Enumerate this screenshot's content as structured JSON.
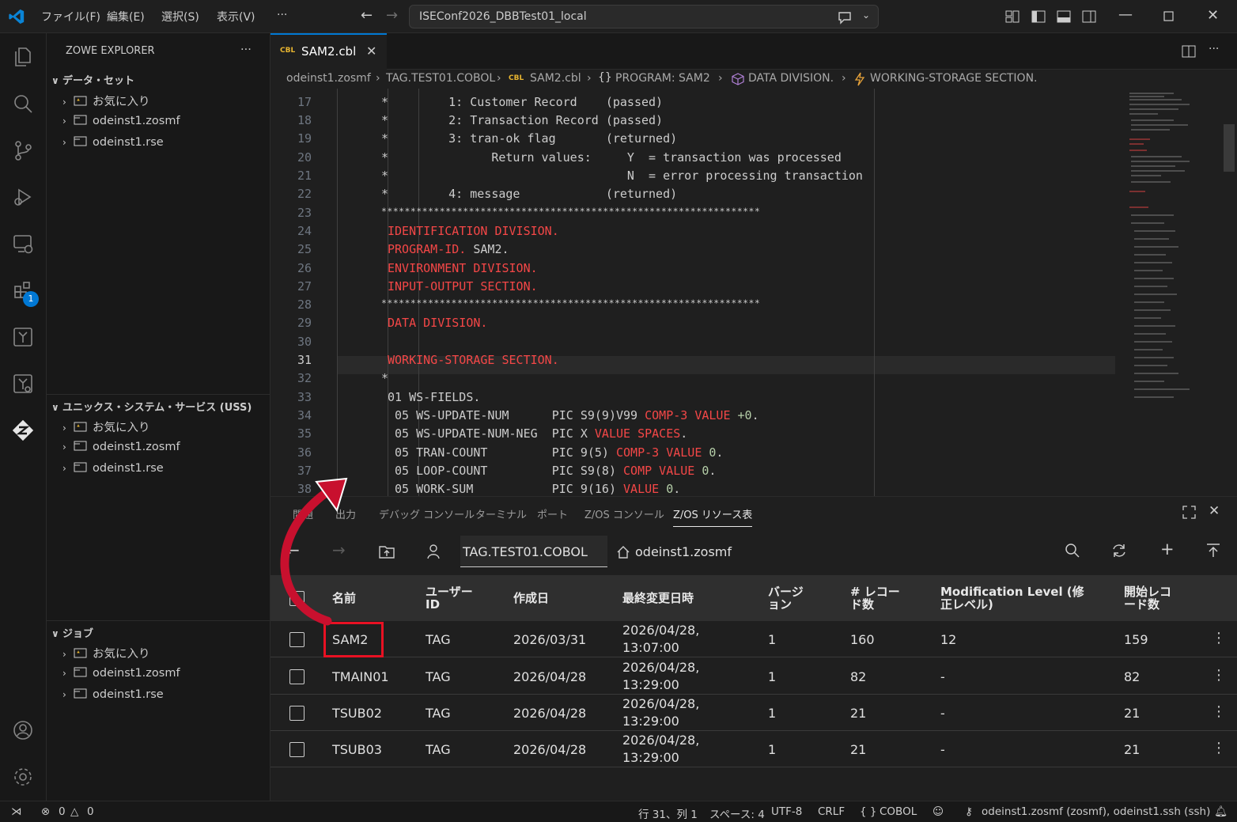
{
  "titlebar": {
    "menus": [
      "ファイル(F)",
      "編集(E)",
      "選択(S)",
      "表示(V)",
      "···"
    ],
    "command_center": "ISEConf2026_DBBTest01_local"
  },
  "activity_bar": {
    "items": [
      "explorer-icon",
      "search-icon",
      "source-control-icon",
      "run-debug-icon",
      "remote-explorer-icon",
      "extensions-icon",
      "zowe-tree-icon",
      "zowe-tree2-icon",
      "zowe-explorer-icon"
    ],
    "extensions_badge": "1",
    "bottom": [
      "account-icon",
      "settings-gear-icon"
    ]
  },
  "sidebar": {
    "title": "ZOWE EXPLORER",
    "more": "···",
    "sections": [
      {
        "title": "データ・セット",
        "items": [
          "お気に入り",
          "odeinst1.zosmf",
          "odeinst1.rse"
        ]
      },
      {
        "title": "ユニックス・システム・サービス (USS)",
        "items": [
          "お気に入り",
          "odeinst1.zosmf",
          "odeinst1.rse"
        ]
      },
      {
        "title": "ジョブ",
        "items": [
          "お気に入り",
          "odeinst1.zosmf",
          "odeinst1.rse"
        ]
      }
    ]
  },
  "editor": {
    "tab_badge": "CBL",
    "tab_label": "SAM2.cbl",
    "breadcrumb": [
      "odeinst1.zosmf",
      "TAG.TEST01.COBOL",
      "SAM2.cbl",
      "PROGRAM: SAM2",
      "DATA DIVISION.",
      "WORKING-STORAGE SECTION."
    ],
    "line_numbers": [
      "17",
      "18",
      "19",
      "20",
      "21",
      "22",
      "23",
      "24",
      "25",
      "26",
      "27",
      "28",
      "29",
      "30",
      "31",
      "32",
      "33",
      "34",
      "35",
      "36",
      "37",
      "38"
    ],
    "lines": {
      "l17": "     1: Customer Record    (passed)",
      "l18": "     2: Transaction Record (passed)",
      "l19": "     3: tran-ok flag       (returned)",
      "l20": "           Return values:     Y  = transaction was processed",
      "l21": "                              N  = error processing transaction",
      "l22": "     4: message            (returned)",
      "l23": "*****************************************************************",
      "l24": "IDENTIFICATION DIVISION.",
      "l25a": "PROGRAM-ID.",
      "l25b": " SAM2.",
      "l26": "ENVIRONMENT DIVISION.",
      "l27": "INPUT-OUTPUT SECTION.",
      "l28": "*****************************************************************",
      "l29": "DATA DIVISION.",
      "l31": "WORKING-STORAGE SECTION.",
      "l33": "01 WS-FIELDS.",
      "l34a": " 05 WS-UPDATE-NUM      PIC S9(9)V99 ",
      "l34b": "COMP-3 VALUE ",
      "l34c": "+0",
      "l35a": " 05 WS-UPDATE-NUM-NEG  PIC X ",
      "l35b": "VALUE SPACES",
      "l36a": " 05 TRAN-COUNT         PIC 9(5) ",
      "l36b": "COMP-3 VALUE ",
      "l36c": "0",
      "l37a": " 05 LOOP-COUNT         PIC S9(8) ",
      "l37b": "COMP VALUE ",
      "l37c": "0",
      "l38a": " 05 WORK-SUM           PIC 9(16) ",
      "l38b": "VALUE ",
      "l38c": "0",
      "star": "*",
      "dot": "."
    }
  },
  "panel": {
    "tabs": [
      "問題",
      "出力",
      "デバッグ コンソール",
      "ターミナル",
      "ポート",
      "Z/OS コンソール",
      "Z/OS リソース表"
    ],
    "active_tab": "Z/OS リソース表",
    "path": "TAG.TEST01.COBOL",
    "profile": "odeinst1.zosmf",
    "columns": [
      "名前",
      "ユーザー ID",
      "作成日",
      "最終変更日時",
      "バージョン",
      "# レコード数",
      "Modification Level (修正レベル)",
      "開始レコード数"
    ],
    "col_lines": {
      "user_1": "ユーザー",
      "user_2": "ID",
      "ver_1": "バージ",
      "ver_2": "ョン",
      "rec_1": "# レコー",
      "rec_2": "ド数",
      "mod_1": "Modification Level (修",
      "mod_2": "正レベル)",
      "start_1": "開始レコ",
      "start_2": "ード数"
    },
    "rows": [
      {
        "name": "SAM2",
        "user": "TAG",
        "created": "2026/03/31",
        "modified_date": "2026/04/28,",
        "modified_time": "13:07:00",
        "version": "1",
        "records": "160",
        "mod_level": "12",
        "start": "159"
      },
      {
        "name": "TMAIN01",
        "user": "TAG",
        "created": "2026/04/28",
        "modified_date": "2026/04/28,",
        "modified_time": "13:29:00",
        "version": "1",
        "records": "82",
        "mod_level": "-",
        "start": "82"
      },
      {
        "name": "TSUB02",
        "user": "TAG",
        "created": "2026/04/28",
        "modified_date": "2026/04/28,",
        "modified_time": "13:29:00",
        "version": "1",
        "records": "21",
        "mod_level": "-",
        "start": "21"
      },
      {
        "name": "TSUB03",
        "user": "TAG",
        "created": "2026/04/28",
        "modified_date": "2026/04/28,",
        "modified_time": "13:29:00",
        "version": "1",
        "records": "21",
        "mod_level": "-",
        "start": "21"
      }
    ],
    "highlight_color": "#e81123"
  },
  "statusbar": {
    "errors": "0",
    "warnings": "0",
    "position": "行 31、列 1",
    "spaces": "スペース: 4",
    "encoding": "UTF-8",
    "eol": "CRLF",
    "language": "COBOL",
    "connection": "odeinst1.zosmf (zosmf), odeinst1.ssh (ssh)"
  }
}
